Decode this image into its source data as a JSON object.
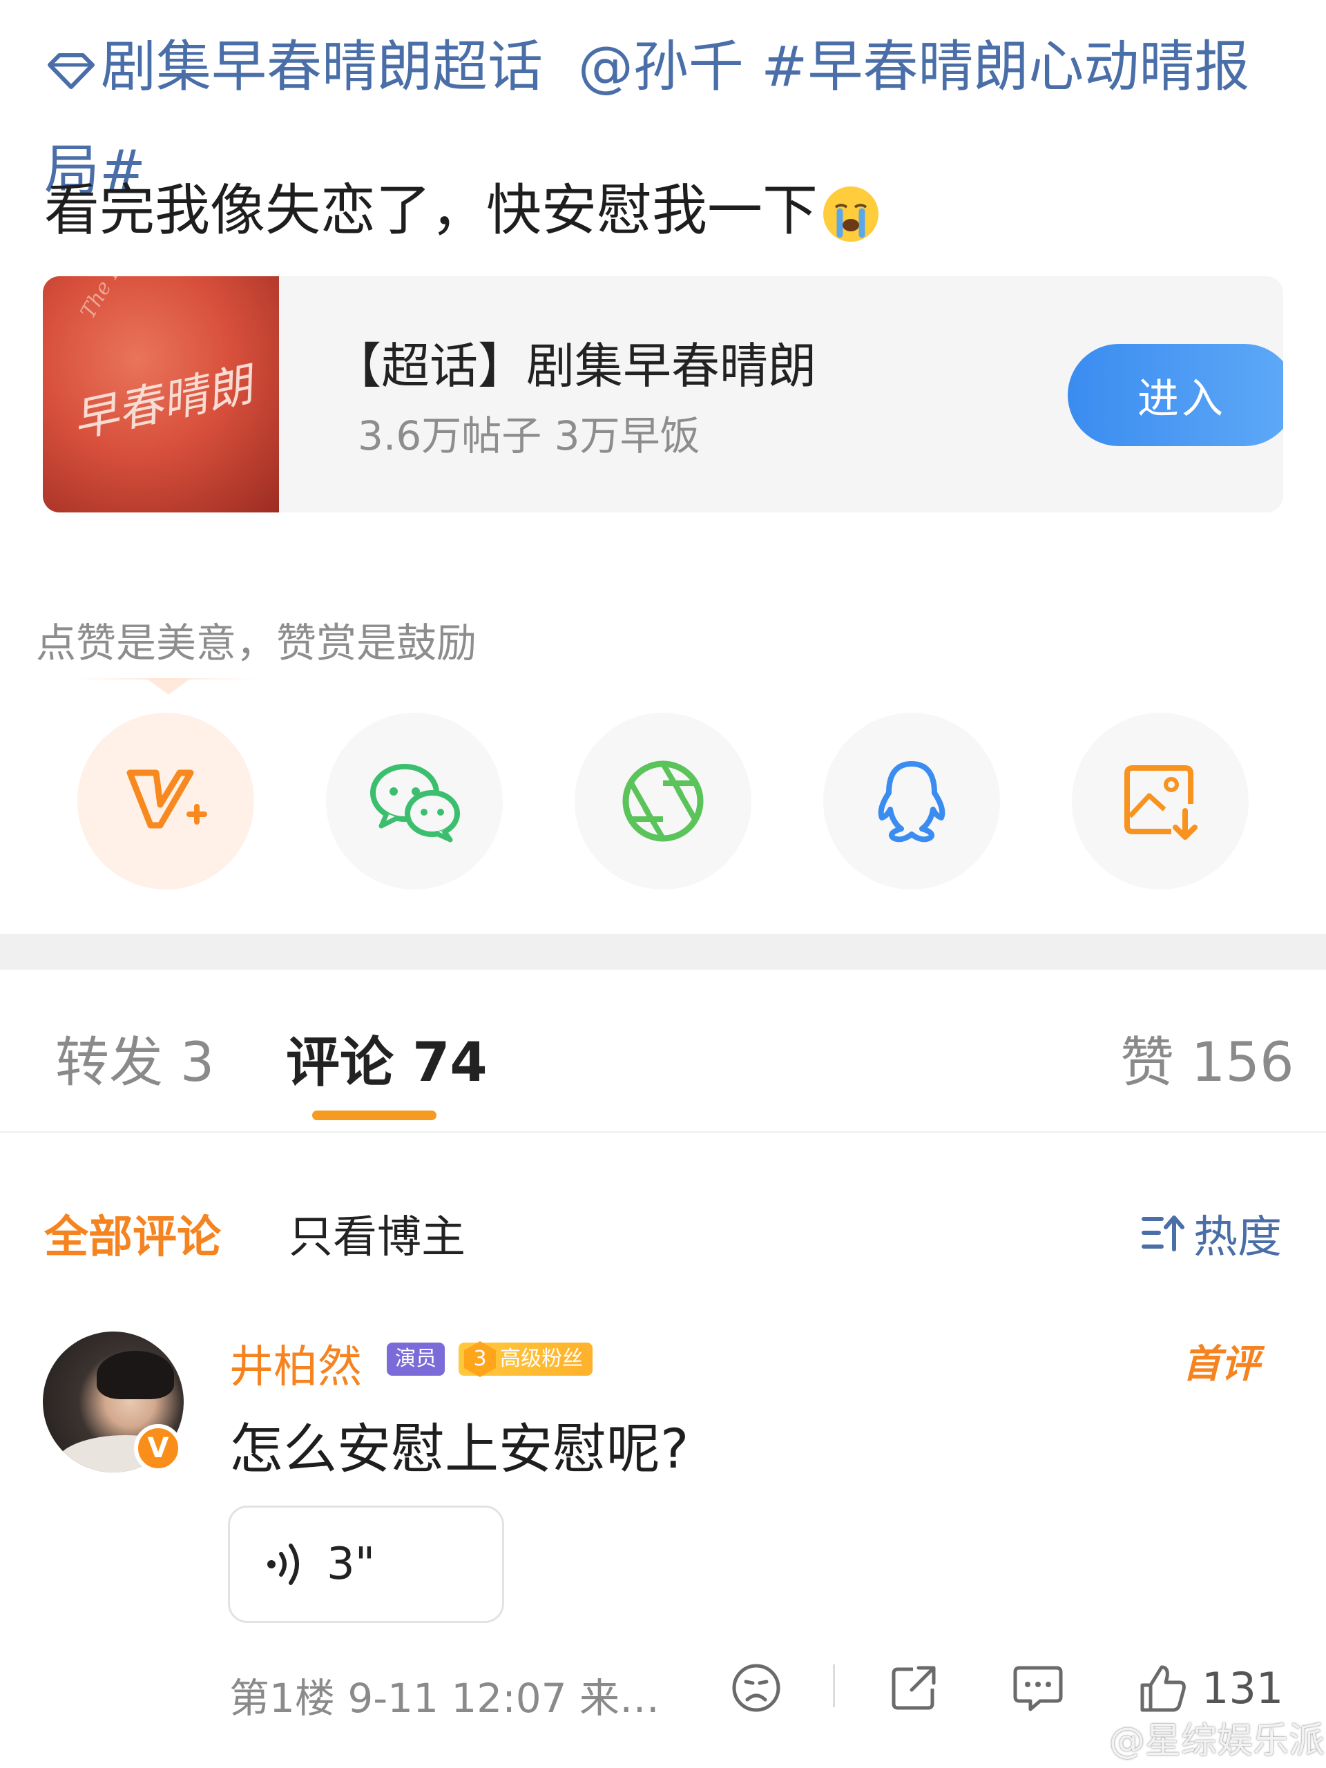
{
  "post": {
    "topic_link": "剧集早春晴朗超话",
    "mention": "@孙千",
    "hashtag": "#早春晴朗心动晴报局#",
    "body": "看完我像失恋了，快安慰我一下"
  },
  "topic_card": {
    "cover_text": "早春晴朗",
    "cover_text_en": "The Early Spring",
    "title": "【超话】剧集早春晴朗",
    "stats": "3.6万帖子 3万早饭",
    "enter_label": "进入"
  },
  "reward_hint": "点赞是美意，赞赏是鼓励",
  "share_icons": [
    "v-plus-icon",
    "wechat-icon",
    "moments-icon",
    "qq-icon",
    "save-image-icon"
  ],
  "tabs": {
    "repost": "转发 3",
    "comments": "评论 74",
    "likes": "赞 156"
  },
  "filters": {
    "all": "全部评论",
    "owner_only": "只看博主",
    "sort": "热度"
  },
  "comment": {
    "username": "井柏然",
    "role_badge": "演员",
    "fan_level": "3",
    "fan_badge": "高级粉丝",
    "first_tag": "首评",
    "verified_mark": "V",
    "text": "怎么安慰上安慰呢?",
    "voice_duration": "3\"",
    "meta": "第1楼  9-11 12:07  来…",
    "like_count": "131"
  },
  "watermark": "@星综娱乐派",
  "colors": {
    "link_blue": "#4a6ea8",
    "accent_orange": "#f58320",
    "enter_button": "#3a8cf0",
    "wechat_green": "#3bbf6e",
    "qq_blue": "#3a8cf0"
  }
}
